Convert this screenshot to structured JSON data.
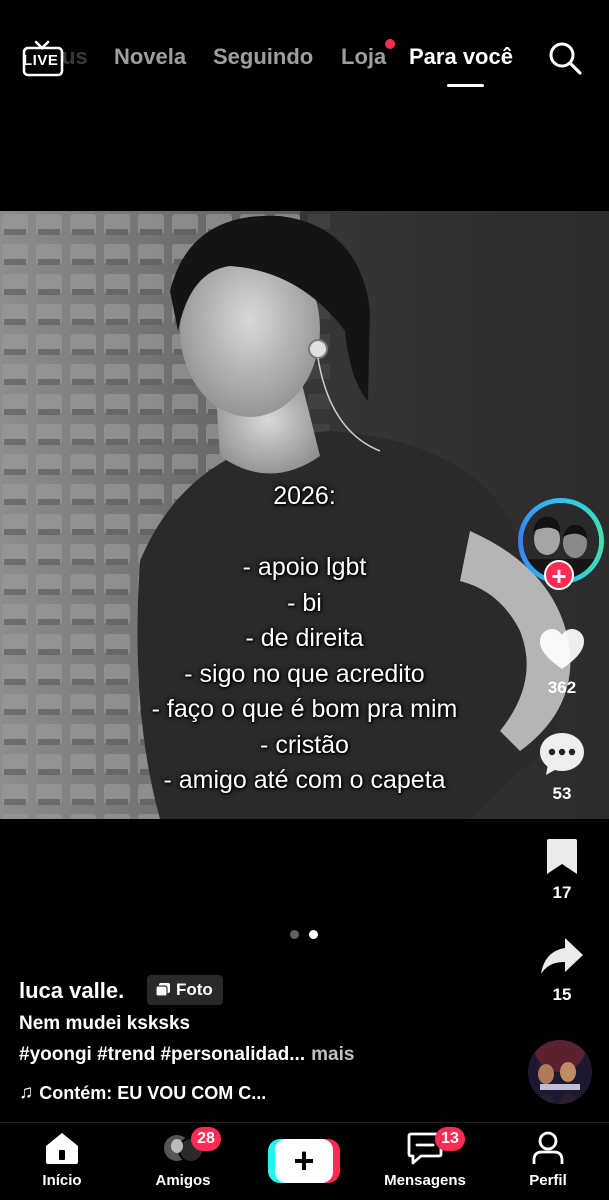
{
  "header": {
    "live_label": "LIVE",
    "faded_tab": "us",
    "tabs": [
      {
        "label": "Novela"
      },
      {
        "label": "Seguindo"
      },
      {
        "label": "Loja"
      },
      {
        "label": "Para você"
      }
    ],
    "active_tab": "Para você",
    "icons": {
      "live": "live-tv-icon",
      "search": "search-icon"
    }
  },
  "post": {
    "overlay_lines": [
      "2026:",
      "",
      "- apoio lgbt",
      "- bi",
      "- de direita",
      "- sigo no que acredito",
      "- faço o que é bom pra mim",
      "- cristão",
      "- amigo até com o capeta"
    ],
    "carousel": {
      "total": 2,
      "current": 2
    }
  },
  "rail": {
    "likes": "362",
    "comments": "53",
    "saves": "17",
    "shares": "15",
    "follow_symbol": "+"
  },
  "caption": {
    "author": "luca valle.",
    "badge": "Foto",
    "title": "Nem mudei ksksks",
    "hashtags": "#yoongi #trend #personalidad...",
    "more": "mais",
    "music": "Contém: EU VOU COM C..."
  },
  "nav": {
    "home": "Início",
    "friends": "Amigos",
    "friends_badge": "28",
    "create_symbol": "+",
    "inbox": "Mensagens",
    "inbox_badge": "13",
    "profile": "Perfil"
  },
  "colors": {
    "accent_red": "#fe2c55",
    "accent_cyan": "#25f4ee",
    "background": "#000000"
  }
}
